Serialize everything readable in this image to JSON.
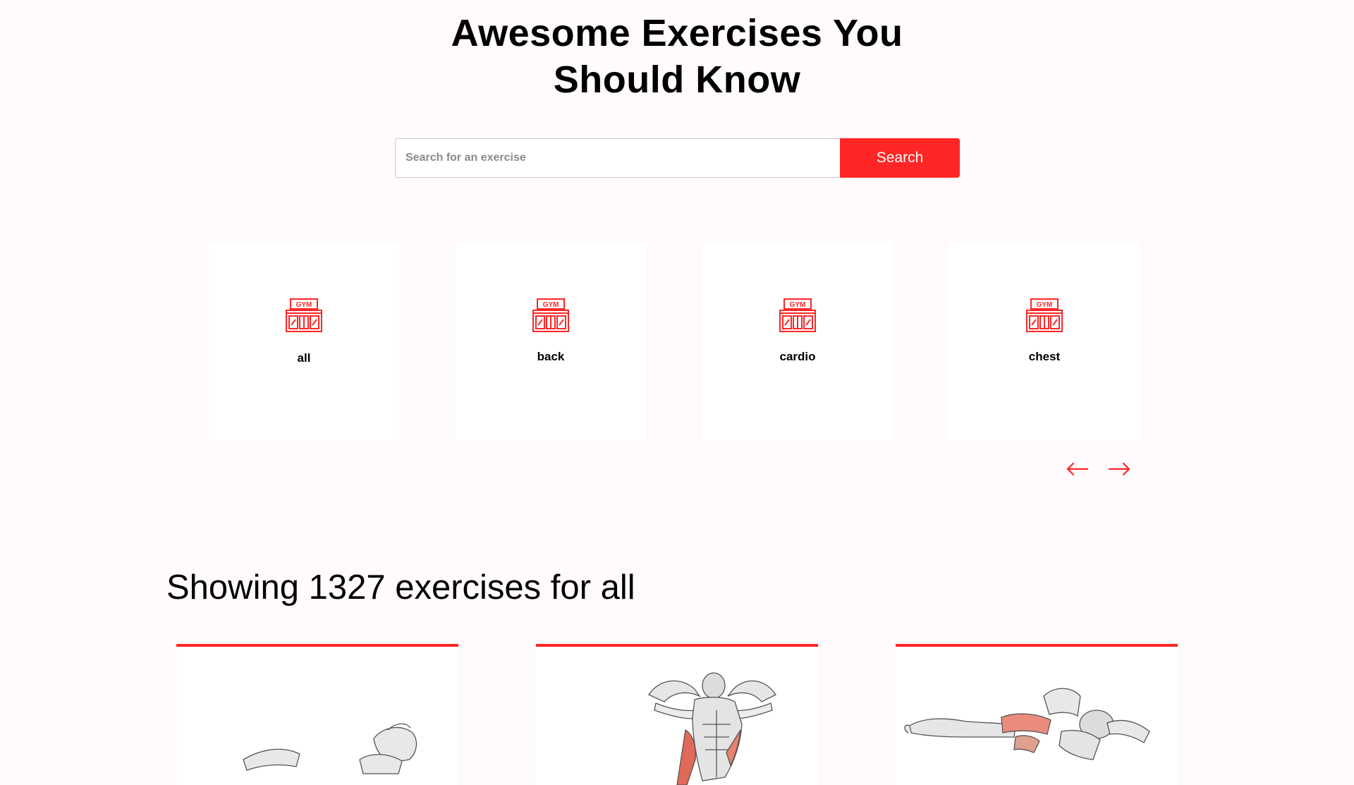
{
  "hero": {
    "title_line1": "Awesome Exercises You",
    "title_line2": "Should Know"
  },
  "search": {
    "placeholder": "Search for an exercise",
    "value": "",
    "button_label": "Search"
  },
  "categories": [
    {
      "label": "all",
      "icon": "gym-icon"
    },
    {
      "label": "back",
      "icon": "gym-icon"
    },
    {
      "label": "cardio",
      "icon": "gym-icon"
    },
    {
      "label": "chest",
      "icon": "gym-icon"
    }
  ],
  "carousel": {
    "prev_icon": "arrow-left-icon",
    "next_icon": "arrow-right-icon"
  },
  "results": {
    "heading": "Showing 1327 exercises for all"
  },
  "exercises": [
    {
      "image": "exercise-illustration"
    },
    {
      "image": "exercise-illustration"
    },
    {
      "image": "exercise-illustration"
    }
  ],
  "colors": {
    "accent": "#ff2625",
    "background": "#fffafb"
  }
}
